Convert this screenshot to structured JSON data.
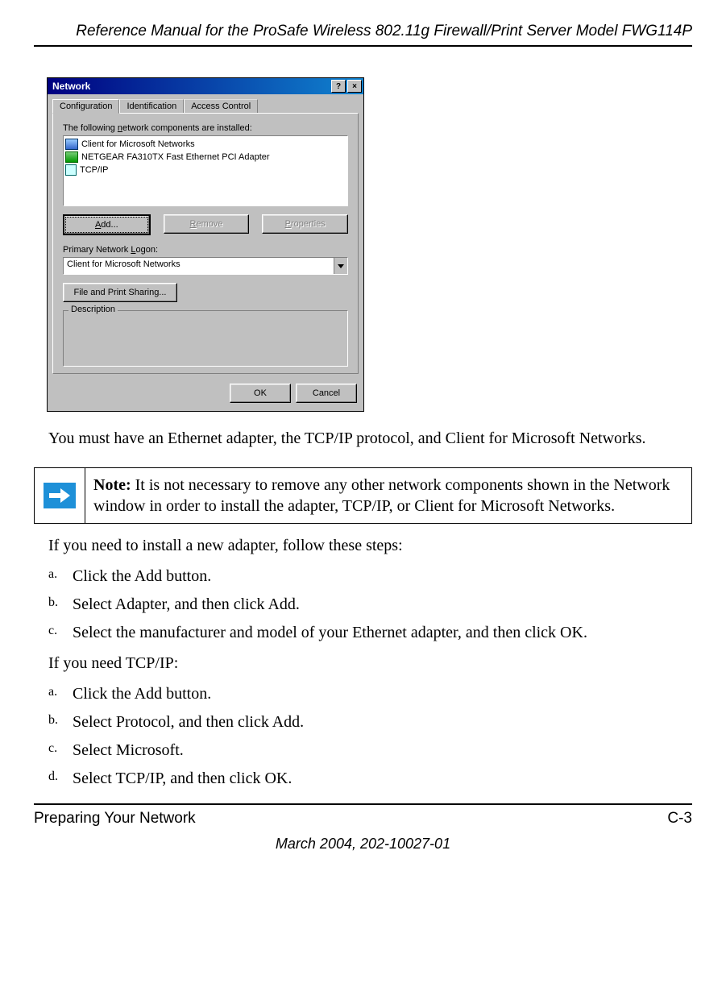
{
  "header": {
    "running_title": "Reference Manual for the ProSafe Wireless 802.11g  Firewall/Print Server Model FWG114P"
  },
  "dialog": {
    "title": "Network",
    "help_btn": "?",
    "close_btn": "×",
    "tabs": {
      "configuration": "Configuration",
      "identification": "Identification",
      "access_control": "Access Control"
    },
    "components_label": "The following network components are installed:",
    "components": {
      "client": "Client for Microsoft Networks",
      "nic": "NETGEAR FA310TX Fast Ethernet PCI Adapter",
      "tcpip": "TCP/IP"
    },
    "buttons": {
      "add": "Add...",
      "remove": "Remove",
      "properties": "Properties"
    },
    "logon_label": "Primary Network Logon:",
    "logon_value": "Client for Microsoft Networks",
    "fps_button": "File and Print Sharing...",
    "description_group": "Description",
    "ok": "OK",
    "cancel": "Cancel"
  },
  "body": {
    "must_have": "You must have an Ethernet adapter, the TCP/IP protocol, and Client for Microsoft Networks.",
    "note_label": "Note:",
    "note_text": " It is not necessary to remove any other network components shown in the Network window in order to install the adapter, TCP/IP, or Client for Microsoft Networks.",
    "install_adapter_intro": "If you need to install a new adapter, follow these steps:",
    "adapter_steps": {
      "a": "Click the Add button.",
      "b": "Select Adapter, and then click Add.",
      "c": "Select the manufacturer and model of your Ethernet adapter, and then click OK."
    },
    "need_tcpip_intro": "If you need TCP/IP:",
    "tcpip_steps": {
      "a": "Click the Add button.",
      "b": "Select Protocol, and then click Add.",
      "c": "Select Microsoft.",
      "d": "Select TCP/IP, and then click OK."
    }
  },
  "footer": {
    "section": "Preparing Your Network",
    "page": "C-3",
    "date": "March 2004, 202-10027-01"
  },
  "letters": {
    "a": "a.",
    "b": "b.",
    "c": "c.",
    "d": "d."
  },
  "underline": {
    "A": "A",
    "R": "R",
    "P": "P",
    "F": "F",
    "L": "L",
    "n": "n"
  }
}
